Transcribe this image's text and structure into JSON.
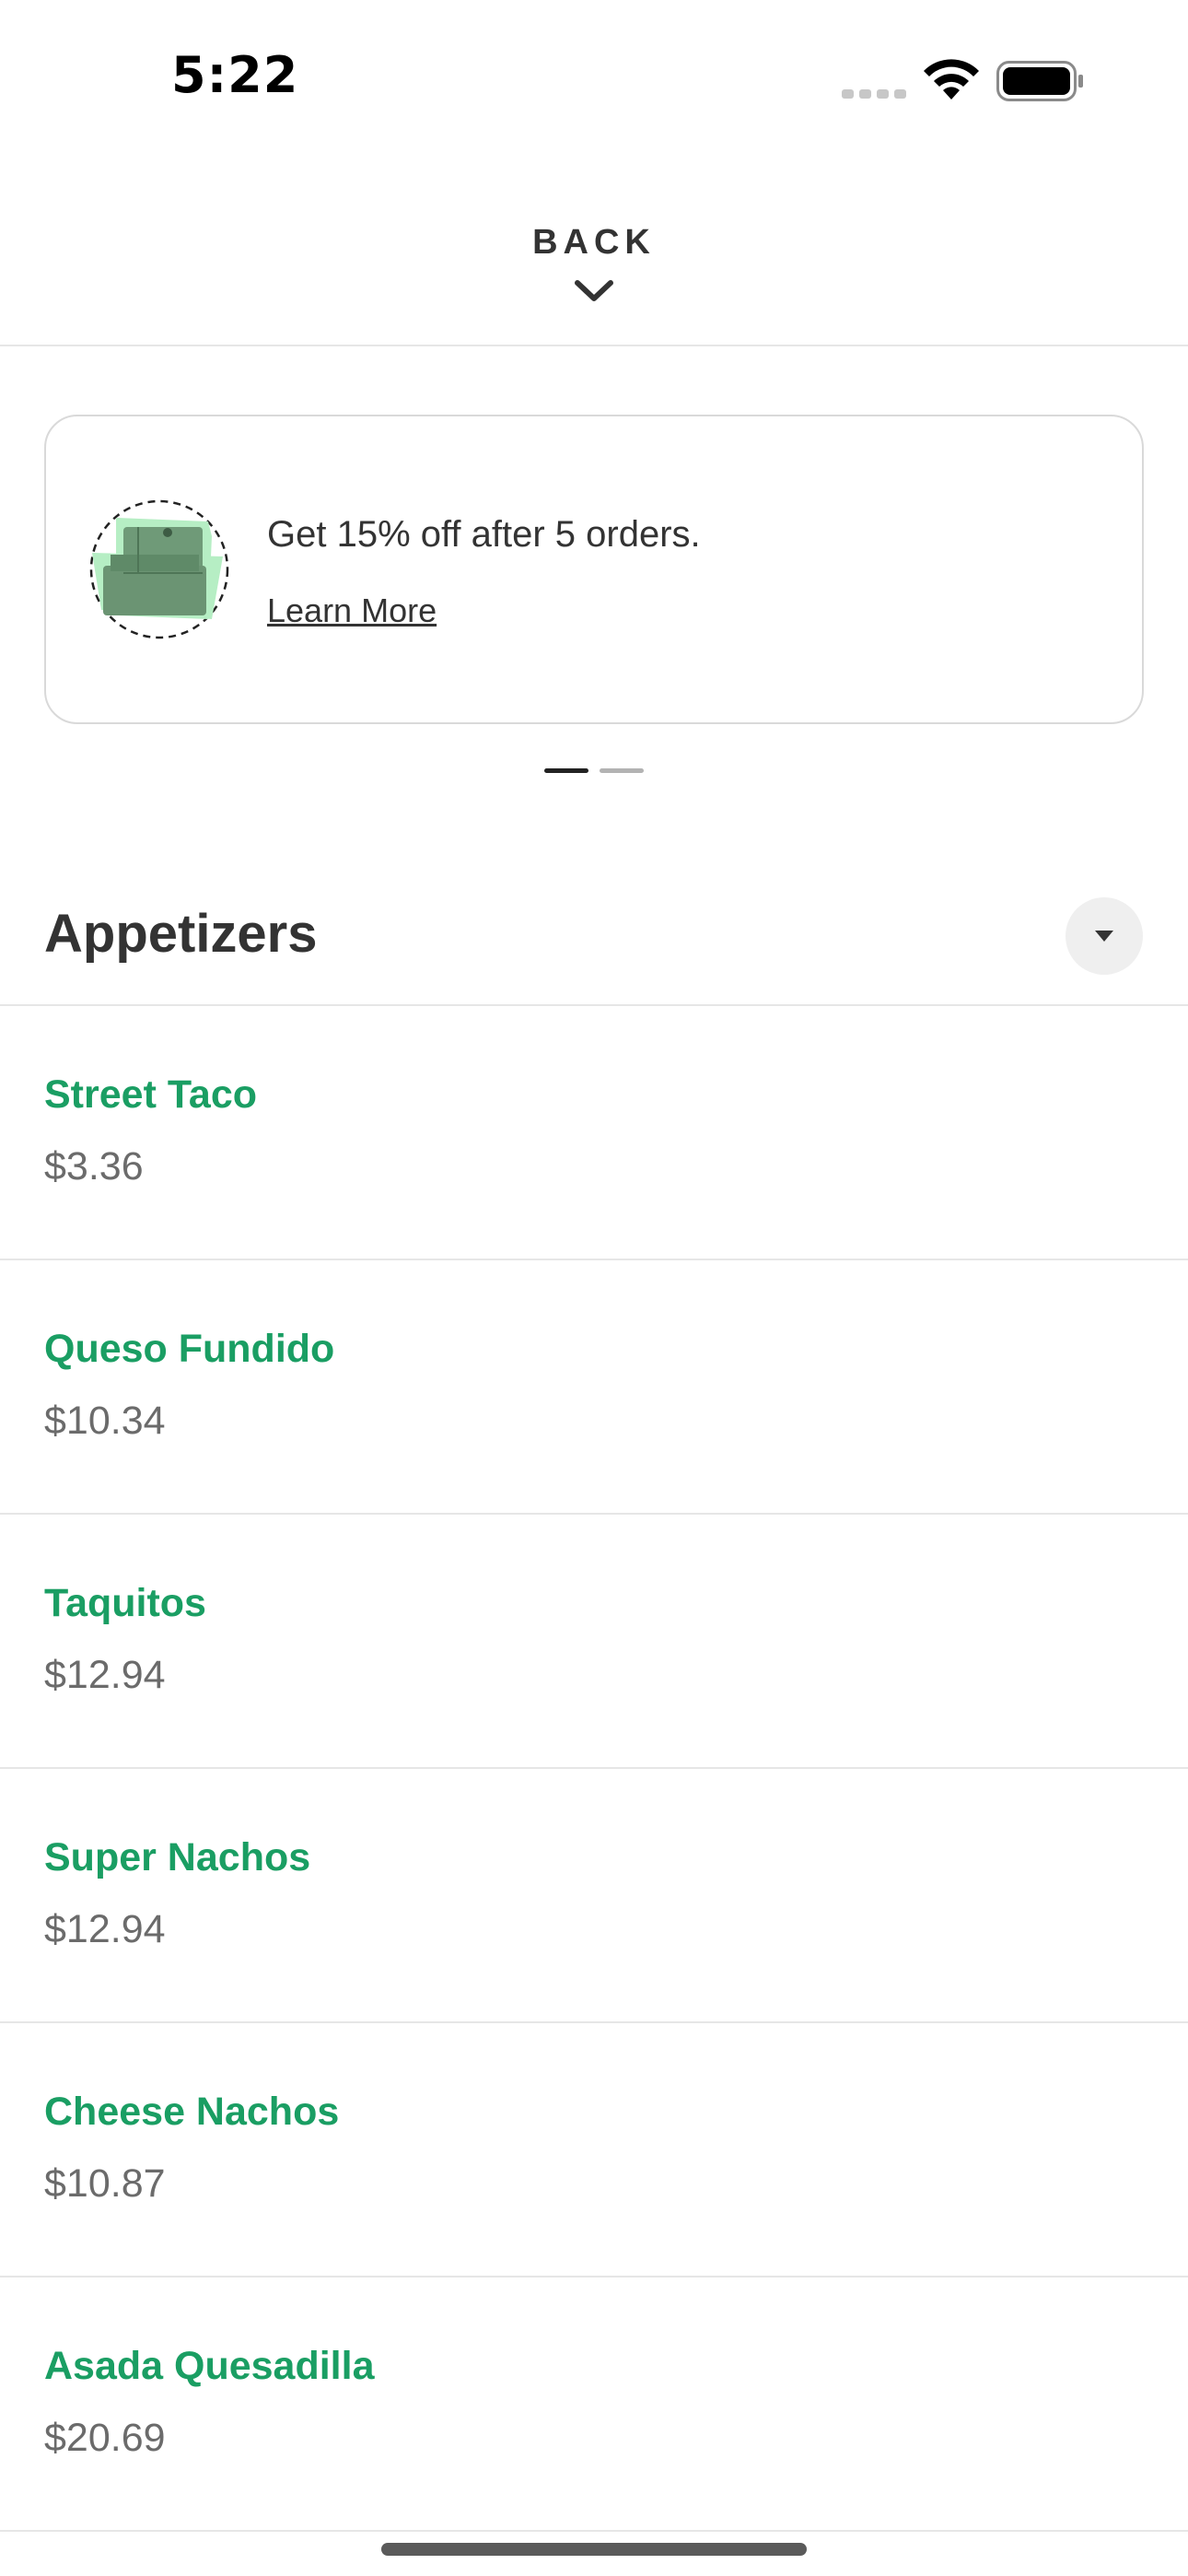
{
  "status_bar": {
    "time": "5:22"
  },
  "header": {
    "back_label": "BACK"
  },
  "promo": {
    "text": "Get 15% off after 5 orders.",
    "link": "Learn More",
    "icon": "stacked-boxes-icon",
    "pager_count": 2,
    "pager_active": 1
  },
  "section": {
    "title": "Appetizers"
  },
  "menu_items": [
    {
      "name": "Street Taco",
      "price": "$3.36"
    },
    {
      "name": "Queso Fundido",
      "price": "$10.34"
    },
    {
      "name": "Taquitos",
      "price": "$12.94"
    },
    {
      "name": "Super Nachos",
      "price": "$12.94"
    },
    {
      "name": "Cheese Nachos",
      "price": "$10.87"
    },
    {
      "name": "Asada Quesadilla",
      "price": "$20.69"
    }
  ],
  "colors": {
    "accent_green": "#1a9e63",
    "text_dark": "#333333",
    "text_muted": "#6b6b6b",
    "divider": "#e6e6e6"
  }
}
